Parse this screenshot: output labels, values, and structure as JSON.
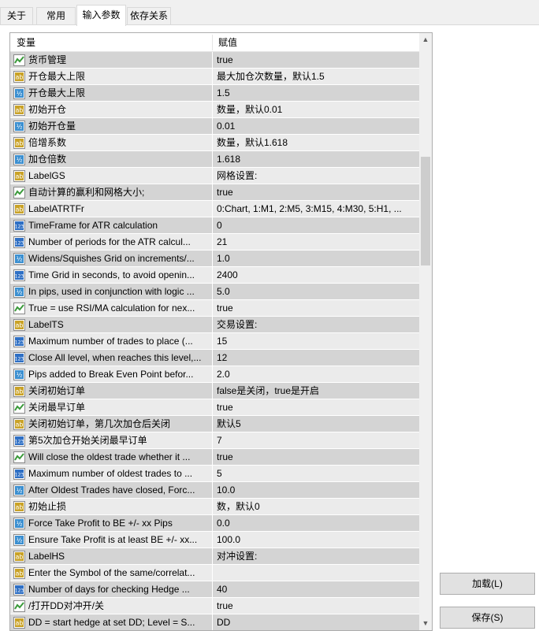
{
  "tabs": [
    {
      "label": "关于",
      "active": false
    },
    {
      "label": "常用",
      "active": false
    },
    {
      "label": "输入参数",
      "active": true
    },
    {
      "label": "依存关系",
      "active": false
    }
  ],
  "grid": {
    "col_variable": "变量",
    "col_value": "赋值",
    "rows": [
      {
        "icon": "bool",
        "name": "货币管理",
        "value": "true"
      },
      {
        "icon": "string",
        "name": "开仓最大上限",
        "value": "最大加仓次数量，默认1.5"
      },
      {
        "icon": "double",
        "name": "开仓最大上限",
        "value": "1.5"
      },
      {
        "icon": "string",
        "name": "初始开仓",
        "value": "数量，默认0.01"
      },
      {
        "icon": "double",
        "name": "初始开仓量",
        "value": "0.01"
      },
      {
        "icon": "string",
        "name": "倍增系数",
        "value": "数量，默认1.618"
      },
      {
        "icon": "double",
        "name": "加仓倍数",
        "value": "1.618"
      },
      {
        "icon": "string",
        "name": "LabelGS",
        "value": "网格设置:"
      },
      {
        "icon": "bool",
        "name": "自动计算的赢利和网格大小;",
        "value": "true"
      },
      {
        "icon": "string",
        "name": "LabelATRTFr",
        "value": "0:Chart, 1:M1, 2:M5, 3:M15, 4:M30, 5:H1, ..."
      },
      {
        "icon": "int",
        "name": "TimeFrame for ATR calculation",
        "value": "0"
      },
      {
        "icon": "int",
        "name": "Number of periods for the ATR calcul...",
        "value": "21"
      },
      {
        "icon": "double",
        "name": "Widens/Squishes Grid on increments/...",
        "value": "1.0"
      },
      {
        "icon": "int",
        "name": "Time Grid in seconds, to avoid openin...",
        "value": "2400"
      },
      {
        "icon": "double",
        "name": "In pips, used in conjunction with logic ...",
        "value": "5.0"
      },
      {
        "icon": "bool",
        "name": "True = use RSI/MA calculation for nex...",
        "value": "true"
      },
      {
        "icon": "string",
        "name": "LabelTS",
        "value": "交易设置:"
      },
      {
        "icon": "int",
        "name": "Maximum number of trades to place (...",
        "value": "15"
      },
      {
        "icon": "int",
        "name": "Close All level, when reaches this level,...",
        "value": "12"
      },
      {
        "icon": "double",
        "name": "Pips added to Break Even Point befor...",
        "value": "2.0"
      },
      {
        "icon": "string",
        "name": "关闭初始订单",
        "value": "false是关闭，true是开启"
      },
      {
        "icon": "bool",
        "name": "关闭最早订单",
        "value": "true"
      },
      {
        "icon": "string",
        "name": "关闭初始订单，第几次加仓后关闭",
        "value": "默认5"
      },
      {
        "icon": "int",
        "name": "第5次加仓开始关闭最早订单",
        "value": "7"
      },
      {
        "icon": "bool",
        "name": "Will close the oldest trade whether it ...",
        "value": "true"
      },
      {
        "icon": "int",
        "name": "Maximum number of oldest trades to ...",
        "value": "5"
      },
      {
        "icon": "double",
        "name": "After Oldest Trades have closed, Forc...",
        "value": "10.0"
      },
      {
        "icon": "string",
        "name": "初始止损",
        "value": "数，默认0"
      },
      {
        "icon": "double",
        "name": "Force Take Profit to BE +/- xx Pips",
        "value": "0.0"
      },
      {
        "icon": "double",
        "name": "Ensure Take Profit is at least BE +/- xx...",
        "value": "100.0"
      },
      {
        "icon": "string",
        "name": "LabelHS",
        "value": "对冲设置:"
      },
      {
        "icon": "string",
        "name": "Enter the Symbol of the same/correlat...",
        "value": ""
      },
      {
        "icon": "int",
        "name": "Number of days for checking Hedge ...",
        "value": "40"
      },
      {
        "icon": "bool",
        "name": "/打开DD对冲开/关",
        "value": "true"
      },
      {
        "icon": "string",
        "name": "DD = start hedge at set DD; Level = S...",
        "value": "DD"
      }
    ]
  },
  "icon_labels": {
    "string": "ab",
    "double": "½",
    "int": "123"
  },
  "colors": {
    "string_icon": "#c9a227",
    "double_icon": "#3b8fd0",
    "int_icon": "#2e6fc4",
    "bool_icon": "#3a9a3a"
  },
  "buttons": {
    "load": "加载(L)",
    "save": "保存(S)"
  }
}
